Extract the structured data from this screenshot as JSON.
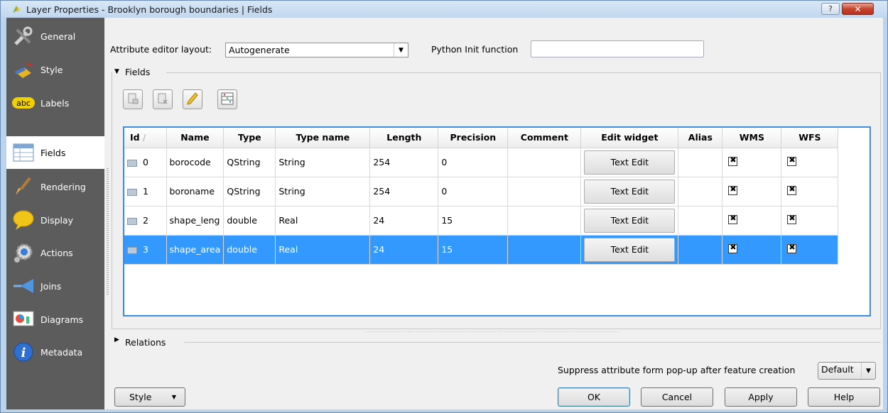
{
  "window": {
    "title": "Layer Properties - Brooklyn borough boundaries | Fields",
    "help_label": "?",
    "close_label": "✕"
  },
  "sidebar": {
    "items": [
      {
        "label": "General",
        "icon": "general-icon"
      },
      {
        "label": "Style",
        "icon": "style-icon"
      },
      {
        "label": "Labels",
        "icon": "labels-icon",
        "badge": "abc"
      },
      {
        "label": "Fields",
        "icon": "fields-icon"
      },
      {
        "label": "Rendering",
        "icon": "rendering-icon"
      },
      {
        "label": "Display",
        "icon": "display-icon"
      },
      {
        "label": "Actions",
        "icon": "actions-icon"
      },
      {
        "label": "Joins",
        "icon": "joins-icon"
      },
      {
        "label": "Diagrams",
        "icon": "diagrams-icon"
      },
      {
        "label": "Metadata",
        "icon": "metadata-icon"
      }
    ],
    "active": "Fields"
  },
  "top": {
    "layout_label": "Attribute editor layout:",
    "layout_value": "Autogenerate",
    "python_label": "Python Init function",
    "python_value": ""
  },
  "fields_group": {
    "label": "Fields"
  },
  "table": {
    "headers": [
      "Id",
      "Name",
      "Type",
      "Type name",
      "Length",
      "Precision",
      "Comment",
      "Edit widget",
      "Alias",
      "WMS",
      "WFS"
    ],
    "rows": [
      {
        "id": "0",
        "name": "borocode",
        "type": "QString",
        "type_name": "String",
        "length": "254",
        "precision": "0",
        "comment": "",
        "widget": "Text Edit",
        "alias": "",
        "wms": true,
        "wfs": true
      },
      {
        "id": "1",
        "name": "boroname",
        "type": "QString",
        "type_name": "String",
        "length": "254",
        "precision": "0",
        "comment": "",
        "widget": "Text Edit",
        "alias": "",
        "wms": true,
        "wfs": true
      },
      {
        "id": "2",
        "name": "shape_leng",
        "type": "double",
        "type_name": "Real",
        "length": "24",
        "precision": "15",
        "comment": "",
        "widget": "Text Edit",
        "alias": "",
        "wms": true,
        "wfs": true
      },
      {
        "id": "3",
        "name": "shape_area",
        "type": "double",
        "type_name": "Real",
        "length": "24",
        "precision": "15",
        "comment": "",
        "widget": "Text Edit",
        "alias": "",
        "wms": true,
        "wfs": true
      }
    ],
    "selected_row": "3"
  },
  "relations": {
    "label": "Relations"
  },
  "suppress": {
    "label": "Suppress attribute form pop-up after feature creation",
    "value": "Default"
  },
  "buttons": {
    "style": "Style",
    "ok": "OK",
    "cancel": "Cancel",
    "apply": "Apply",
    "help": "Help"
  },
  "colors": {
    "selection": "#3399ff",
    "sidebar": "#5c5c5c",
    "table_border": "#3d8ee3"
  }
}
